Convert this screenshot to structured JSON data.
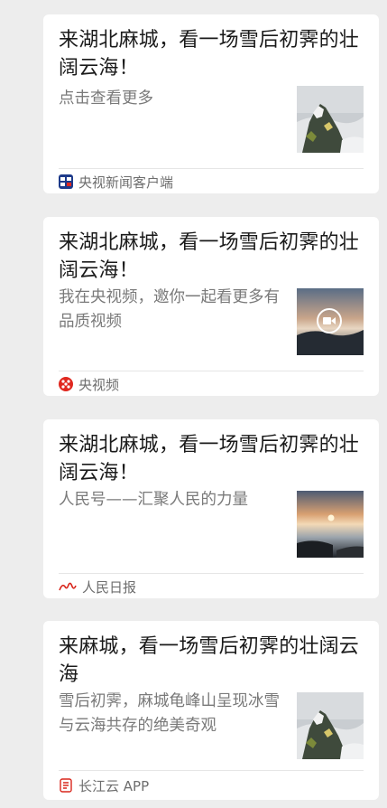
{
  "cards": [
    {
      "title": "来湖北麻城，看一场雪后初霁的壮阔云海！",
      "description": "点击查看更多",
      "source": "央视新闻客户端",
      "thumbnail": "mountain-cloud-sea-icon"
    },
    {
      "title": "来湖北麻城，看一场雪后初霁的壮阔云海！",
      "description": "我在央视频，邀你一起看更多有品质视频",
      "source": "央视频",
      "thumbnail": "video-icon"
    },
    {
      "title": "来湖北麻城，看一场雪后初霁的壮阔云海！",
      "description": "人民号——汇聚人民的力量",
      "source": "人民日报",
      "thumbnail": "sunrise-sea-icon"
    },
    {
      "title": "来麻城，看一场雪后初霁的壮阔云海",
      "description": "雪后初霁，麻城龟峰山呈现冰雪与云海共存的绝美奇观",
      "source": "长江云 APP",
      "thumbnail": "mountain-cloud-sea-icon"
    }
  ],
  "colors": {
    "background": "#ededed",
    "card": "#ffffff",
    "title": "#1a1a1a",
    "description": "#7a7a7a",
    "source": "#6e6e6e",
    "cctv_news_logo": "#1d3a8a",
    "cctv_video_logo": "#e0281f",
    "peoples_daily_logo": "#d9261c"
  }
}
